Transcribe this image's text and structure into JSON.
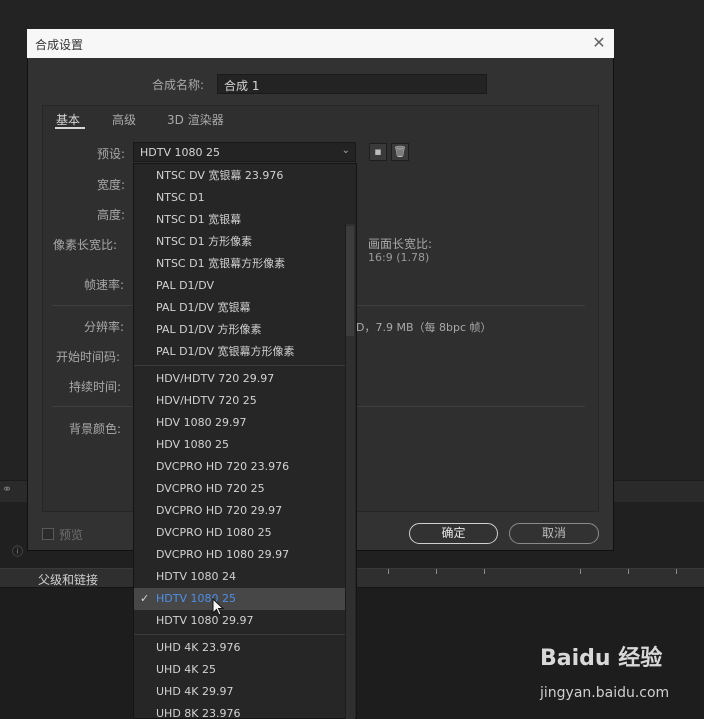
{
  "dialog": {
    "title": "合成设置",
    "comp_name_label": "合成名称:",
    "comp_name_value": "合成 1",
    "tabs": [
      "基本",
      "高级",
      "3D 渲染器"
    ],
    "preset_label": "预设:",
    "preset_value": "HDTV 1080 25",
    "fields": {
      "width": "宽度:",
      "height": "高度:",
      "pixel_aspect": "像素长宽比:",
      "frame_aspect_label": "画面长宽比:",
      "frame_aspect_value": "16:9 (1.78)",
      "frame_rate": "帧速率:",
      "resolution": "分辨率:",
      "resolution_info": "D，7.9 MB（每 8bpc 帧）",
      "start_timecode": "开始时间码:",
      "duration": "持续时间:",
      "background_color": "背景颜色:"
    },
    "preview_label": "预览",
    "ok_label": "确定",
    "cancel_label": "取消"
  },
  "background": {
    "parent_link_label": "父级和链接"
  },
  "preset_dropdown": {
    "groups": [
      [
        "NTSC DV 宽银幕 23.976",
        "NTSC D1",
        "NTSC D1 宽银幕",
        "NTSC D1 方形像素",
        "NTSC D1 宽银幕方形像素",
        "PAL D1/DV",
        "PAL D1/DV 宽银幕",
        "PAL D1/DV 方形像素",
        "PAL D1/DV 宽银幕方形像素"
      ],
      [
        "HDV/HDTV 720 29.97",
        "HDV/HDTV 720 25",
        "HDV 1080 29.97",
        "HDV 1080 25",
        "DVCPRO HD 720 23.976",
        "DVCPRO HD 720 25",
        "DVCPRO HD 720 29.97",
        "DVCPRO HD 1080 25",
        "DVCPRO HD 1080 29.97",
        "HDTV 1080 24",
        "HDTV 1080 25",
        "HDTV 1080 29.97"
      ],
      [
        "UHD 4K 23.976",
        "UHD 4K 25",
        "UHD 4K 29.97",
        "UHD 8K 23.976"
      ]
    ],
    "selected": "HDTV 1080 25"
  },
  "watermark": {
    "brand": "Baidu 经验",
    "url": "jingyan.baidu.com"
  },
  "icons": {
    "close": "close-icon",
    "chevron": "chevron-down-icon",
    "save_preset": "save-preset-icon",
    "delete_preset": "trash-icon",
    "check": "checkmark-icon",
    "cursor": "mouse-pointer-icon"
  }
}
